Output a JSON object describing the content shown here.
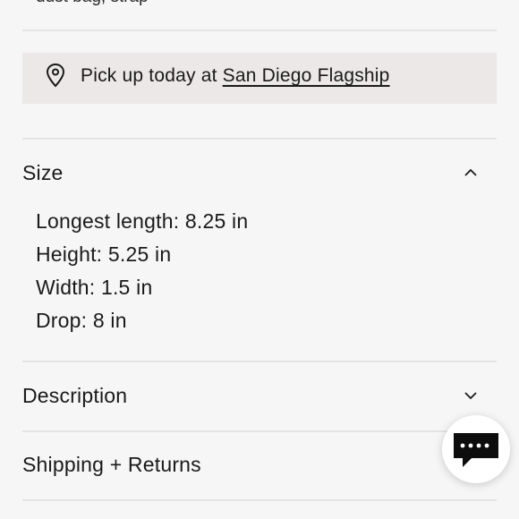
{
  "top_cut_text": "dust bag, strap",
  "pickup": {
    "prefix": "Pick up today at",
    "store_link": "San Diego Flagship",
    "icon": "map-pin-icon"
  },
  "accordions": {
    "size": {
      "title": "Size",
      "expanded": true,
      "lines": [
        "Longest length: 8.25 in",
        "Height: 5.25 in",
        "Width: 1.5 in",
        "Drop: 8 in"
      ]
    },
    "description": {
      "title": "Description",
      "expanded": false
    },
    "shipping": {
      "title": "Shipping + Returns",
      "expanded": false
    }
  },
  "chat": {
    "icon": "chat-bubble-icon"
  }
}
